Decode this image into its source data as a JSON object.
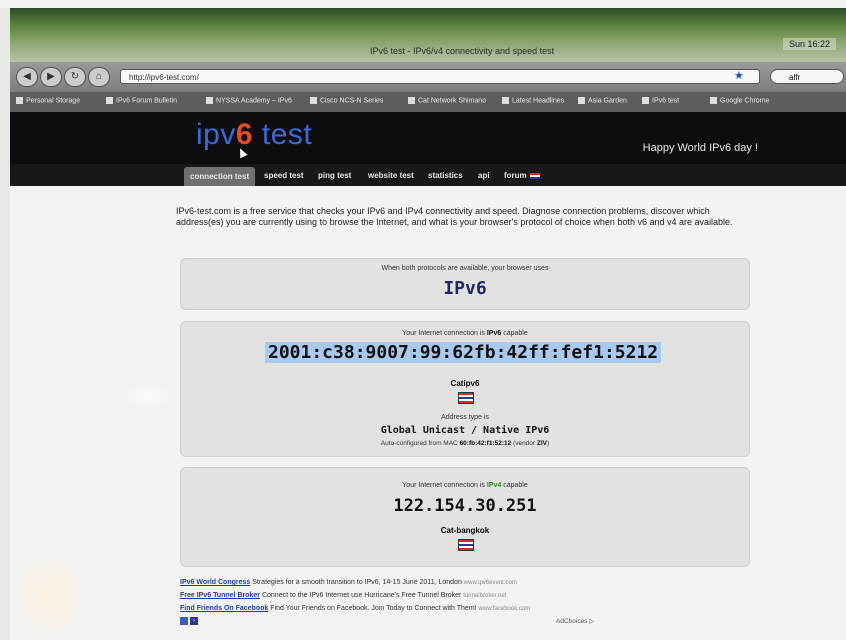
{
  "browser": {
    "window_title": "IPv6 test - IPv6/v4 connectivity and speed test",
    "menubar_right": "Sun 16:22",
    "url": "http://ipv6-test.com/",
    "search_placeholder": "alfr",
    "back_icon": "chevron-left-icon",
    "forward_icon": "chevron-right-icon",
    "bookmarks": [
      "Personal Storage",
      "IPv6 Forum Bulletin",
      "NYSSA Academy – IPv6",
      "Cisco NCS-N Series",
      "Cat Network Shimano",
      "Latest Headlines",
      "Asia Garden",
      "IPv6 test",
      "Google Chrome"
    ],
    "bookmark_star": "★"
  },
  "site": {
    "logo_prefix": "ipv",
    "logo_digit": "6",
    "logo_suffix": " test",
    "tagline": "Happy World IPv6 day !",
    "nav": [
      "connection test",
      "speed test",
      "ping test",
      "website test",
      "statistics",
      "api",
      "forum"
    ],
    "intro": "IPv6-test.com is a free service that checks your IPv6 and IPv4 connectivity and speed. Diagnose connection problems, discover which address(es) you are currently using to browse the Internet, and what is your browser's protocol of choice when both v6 and v4 are available."
  },
  "protocol_card": {
    "label": "When both protocols are available, your browser uses",
    "value": "IPv6"
  },
  "ipv6_card": {
    "label_prefix": "Your Internet connection is ",
    "label_bold": "IPv6",
    "label_suffix": " capable",
    "address": "2001:c38:9007:99:62fb:42ff:fef1:5212",
    "isp": "Catipv6",
    "address_type_label": "Address type is",
    "address_type": "Global Unicast / Native IPv6",
    "autoconf_prefix": "Auto-configured from MAC ",
    "autoconf_mac": "60:fb:42:f1:52:12",
    "autoconf_vendor_prefix": " (vendor ",
    "autoconf_vendor": "ZIV",
    "autoconf_suffix": ")"
  },
  "ipv4_card": {
    "label_prefix": "Your Internet connection is ",
    "label_bold": "IPv4",
    "label_suffix": " capable",
    "address": "122.154.30.251",
    "isp": "Cat-bangkok"
  },
  "ads": [
    {
      "link": "IPv6 World Congress",
      "text": " Strategies for a smooth transition to IPv6, 14-15 June 2011, London ",
      "url": "www.ipv6event.com"
    },
    {
      "link": "Free IPv6 Tunnel Broker",
      "text": " Connect to the IPv6 Internet use Hurricane's Free Tunnel Broker ",
      "url": "tunnelbroker.net"
    },
    {
      "link": "Find Friends On Facebook",
      "text": " Find Your Friends on Facebook. Join Today to Connect with Them! ",
      "url": "www.facebook.com"
    }
  ],
  "adchoices": "AdChoices ▷"
}
